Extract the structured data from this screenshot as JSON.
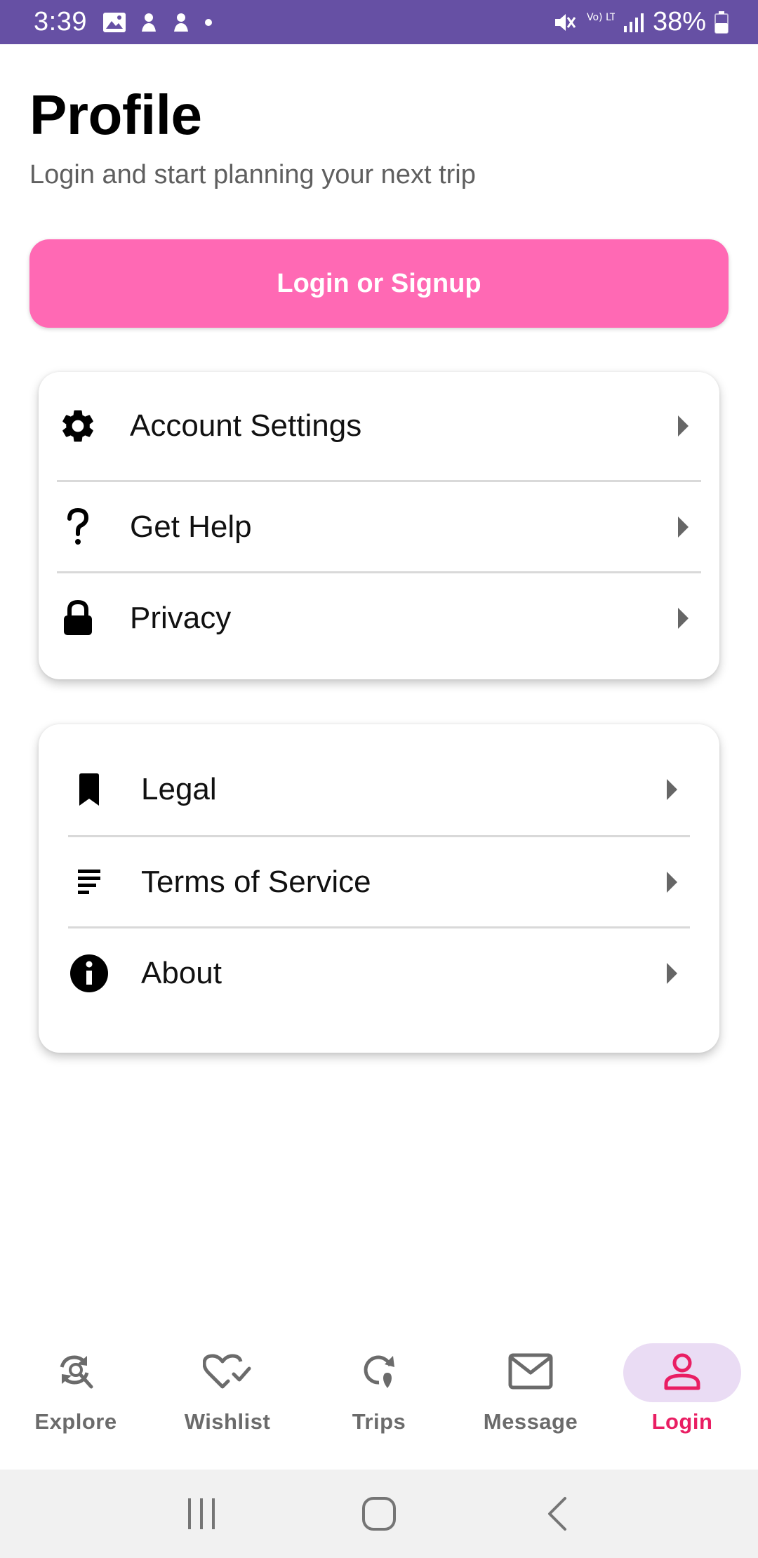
{
  "status_bar": {
    "time": "3:39",
    "battery": "38%",
    "network_label": "Vo) LTE1",
    "left_icons": [
      "image-icon",
      "notification-icon",
      "notification-icon",
      "dot-icon"
    ],
    "right_icons": [
      "mute-icon",
      "volte-icon",
      "signal-icon",
      "battery-icon"
    ]
  },
  "header": {
    "title": "Profile",
    "subtitle": "Login and start planning your next trip"
  },
  "login_button": {
    "label": "Login or Signup"
  },
  "settings_group": [
    {
      "label": "Account Settings",
      "icon": "gear-icon"
    },
    {
      "label": "Get Help",
      "icon": "question-icon"
    },
    {
      "label": "Privacy",
      "icon": "lock-icon"
    }
  ],
  "info_group": [
    {
      "label": "Legal",
      "icon": "bookmark-icon"
    },
    {
      "label": "Terms of Service",
      "icon": "notes-icon"
    },
    {
      "label": "About",
      "icon": "info-icon"
    }
  ],
  "bottom_nav": [
    {
      "label": "Explore",
      "icon": "explore-icon",
      "active": false
    },
    {
      "label": "Wishlist",
      "icon": "heart-check-icon",
      "active": false
    },
    {
      "label": "Trips",
      "icon": "trips-icon",
      "active": false
    },
    {
      "label": "Message",
      "icon": "mail-icon",
      "active": false
    },
    {
      "label": "Login",
      "icon": "person-icon",
      "active": true
    }
  ],
  "system_nav": [
    "recents-button",
    "home-button",
    "back-button"
  ],
  "colors": {
    "status_bar": "#6650a4",
    "primary_button": "#ff69b4",
    "active_nav": "#e91e63",
    "active_nav_pill": "#eadcf4"
  }
}
